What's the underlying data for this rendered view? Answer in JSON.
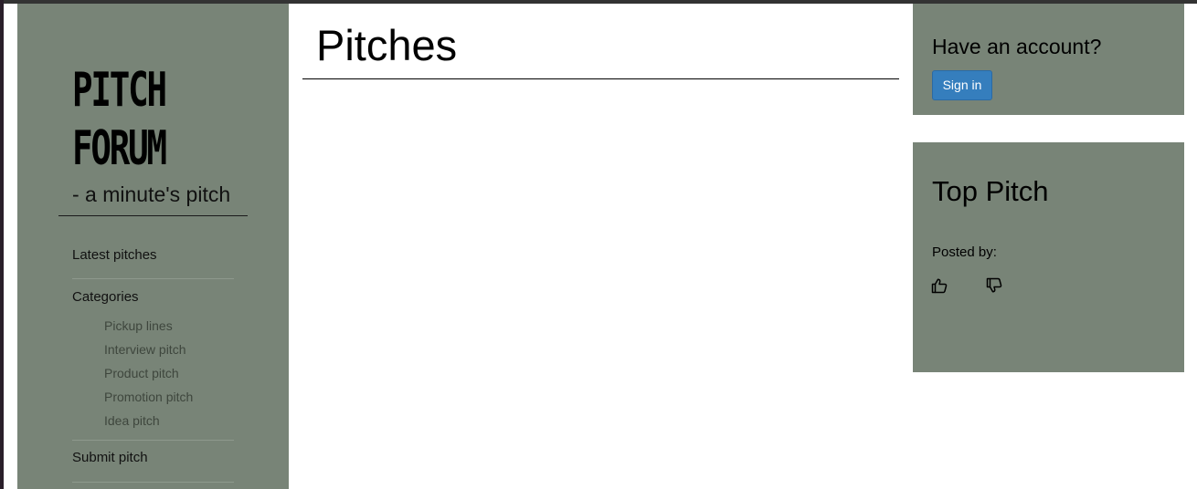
{
  "brand": {
    "line1": "PITCH",
    "line2": "FORUM",
    "tagline": "- a minute's pitch"
  },
  "nav": {
    "latest": "Latest pitches",
    "categories": "Categories",
    "category_items": [
      "Pickup lines",
      "Interview pitch",
      "Product pitch",
      "Promotion pitch",
      "Idea pitch"
    ],
    "submit": "Submit pitch"
  },
  "main": {
    "title": "Pitches"
  },
  "account": {
    "heading": "Have an account?",
    "signin_label": "Sign in"
  },
  "top_pitch": {
    "heading": "Top Pitch",
    "posted_by_label": "Posted by:",
    "upvote_icon": "thumbs-up-icon",
    "downvote_icon": "thumbs-down-icon"
  },
  "colors": {
    "sidebar_bg": "#788477",
    "button_bg": "#357ebd"
  }
}
